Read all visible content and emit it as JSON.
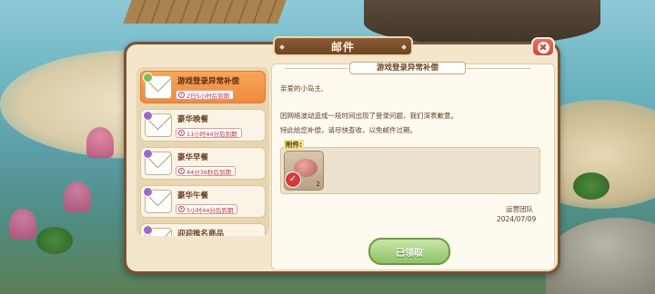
{
  "window": {
    "title": "邮件"
  },
  "mail_list": [
    {
      "title": "游戏登录异常补偿",
      "expires": "2日5小时后到期",
      "active": true
    },
    {
      "title": "豪华晚餐",
      "expires": "11小时44分后到期",
      "active": false
    },
    {
      "title": "豪华早餐",
      "expires": "44分36秒后到期",
      "active": false
    },
    {
      "title": "豪华午餐",
      "expires": "5小时44分后到期",
      "active": false
    },
    {
      "title": "迎迎推名商品",
      "expires": "",
      "active": false
    }
  ],
  "mail": {
    "subject": "游戏登录异常补偿",
    "greeting": "亲爱的小岛主,",
    "body_line1": "因网络波动造成一段时间出现了登录问题，我们深表歉意。",
    "body_line2": "特此给您补偿，请尽快查收，以免邮件过期。",
    "attachment_label": "附件:",
    "attachment_qty": "2",
    "attachment_claimed": true,
    "signature": "运营团队",
    "date": "2024/07/09"
  },
  "actions": {
    "claim_label": "已领取"
  },
  "icons": [
    "close-icon",
    "envelope-icon",
    "clock-icon",
    "check-icon"
  ]
}
